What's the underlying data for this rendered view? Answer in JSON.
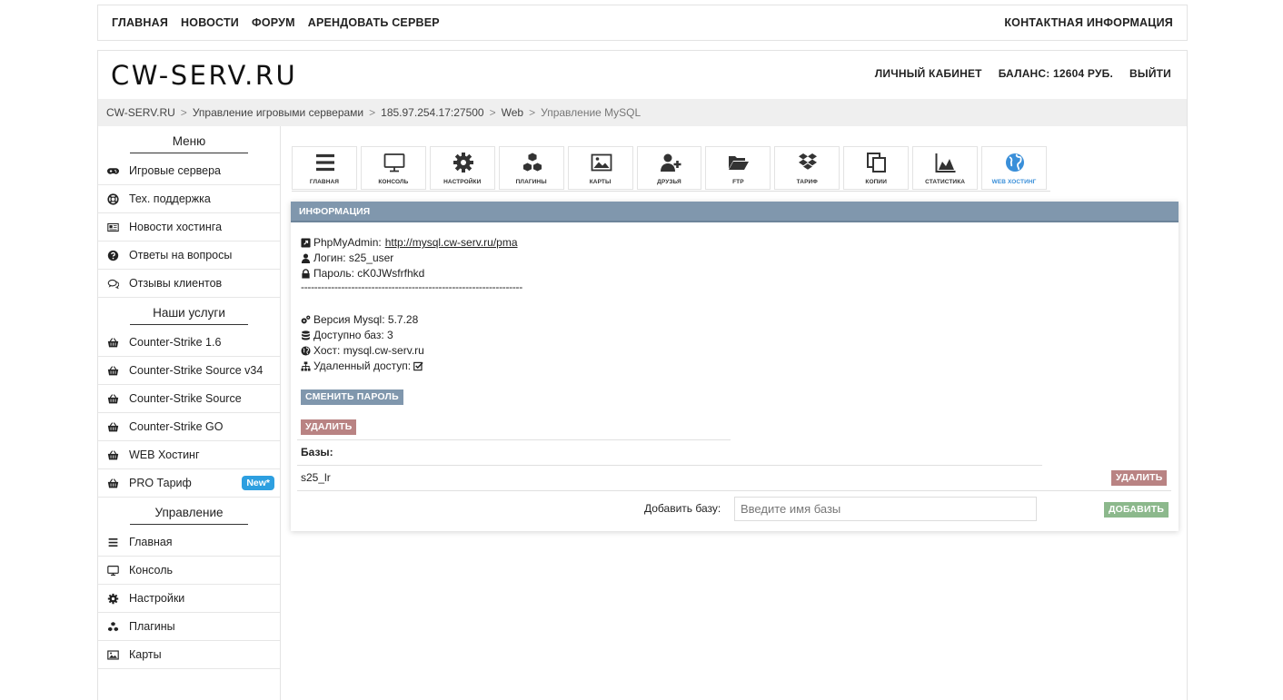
{
  "topnav": {
    "items": [
      "ГЛАВНАЯ",
      "НОВОСТИ",
      "ФОРУМ",
      "АРЕНДОВАТЬ СЕРВЕР"
    ],
    "contact": "КОНТАКТНАЯ ИНФОРМАЦИЯ"
  },
  "header": {
    "logo": "CW-SERV.RU",
    "cabinet": "ЛИЧНЫЙ КАБИНЕТ",
    "balance": "БАЛАНС: 12604 РУБ.",
    "logout": "ВЫЙТИ"
  },
  "breadcrumb": [
    "CW-SERV.RU",
    "Управление игровыми серверами",
    "185.97.254.17:27500",
    "Web",
    "Управление MySQL"
  ],
  "sidebar": {
    "menu_title": "Меню",
    "menu": [
      {
        "label": "Игровые сервера",
        "icon": "gamepad-icon"
      },
      {
        "label": "Тех. поддержка",
        "icon": "lifebuoy-icon"
      },
      {
        "label": "Новости хостинга",
        "icon": "newspaper-icon"
      },
      {
        "label": "Ответы на вопросы",
        "icon": "question-icon"
      },
      {
        "label": "Отзывы клиентов",
        "icon": "comments-icon"
      }
    ],
    "services_title": "Наши услуги",
    "services": [
      {
        "label": "Counter-Strike 1.6",
        "icon": "basket-icon"
      },
      {
        "label": "Counter-Strike Source v34",
        "icon": "basket-icon"
      },
      {
        "label": "Counter-Strike Source",
        "icon": "basket-icon"
      },
      {
        "label": "Counter-Strike GO",
        "icon": "basket-icon"
      },
      {
        "label": "WEB Хостинг",
        "icon": "basket-icon"
      },
      {
        "label": "PRO Тариф",
        "icon": "basket-icon",
        "badge": "New*"
      }
    ],
    "manage_title": "Управление",
    "manage": [
      {
        "label": "Главная",
        "icon": "bars-icon"
      },
      {
        "label": "Консоль",
        "icon": "monitor-icon"
      },
      {
        "label": "Настройки",
        "icon": "gear-icon"
      },
      {
        "label": "Плагины",
        "icon": "cubes-icon"
      },
      {
        "label": "Карты",
        "icon": "image-icon"
      }
    ]
  },
  "toolbar": [
    {
      "label": "ГЛАВНАЯ",
      "icon": "bars-icon"
    },
    {
      "label": "КОНСОЛЬ",
      "icon": "monitor-icon"
    },
    {
      "label": "НАСТРОЙКИ",
      "icon": "gear-icon"
    },
    {
      "label": "ПЛАГИНЫ",
      "icon": "cubes-icon"
    },
    {
      "label": "КАРТЫ",
      "icon": "image-icon"
    },
    {
      "label": "ДРУЗЬЯ",
      "icon": "user-plus-icon"
    },
    {
      "label": "FTP",
      "icon": "folder-open-icon"
    },
    {
      "label": "ТАРИФ",
      "icon": "dropbox-icon"
    },
    {
      "label": "КОПИИ",
      "icon": "copy-icon"
    },
    {
      "label": "СТАТИСТИКА",
      "icon": "area-chart-icon"
    },
    {
      "label": "WEB ХОСТИНГ",
      "icon": "globe-icon",
      "active": true
    }
  ],
  "panel": {
    "title": "ИНФОРМАЦИЯ",
    "phpmyadmin_label": "PhpMyAdmin:",
    "phpmyadmin_url": "http://mysql.cw-serv.ru/pma",
    "login": "Логин: s25_user",
    "password": "Пароль: cK0JWsfrfhkd",
    "divider": "------------------------------------------------------------------",
    "version": "Версия Mysql: 5.7.28",
    "available": "Доступно баз: 3",
    "host": "Хост: mysql.cw-serv.ru",
    "remote": "Удаленный доступ:",
    "change_password": "СМЕНИТЬ ПАРОЛЬ",
    "delete": "УДАЛИТЬ",
    "bases_label": "Базы:",
    "bases": [
      {
        "name": "s25_lr",
        "delete": "УДАЛИТЬ"
      }
    ],
    "add_label": "Добавить базу:",
    "add_placeholder": "Введите имя базы",
    "add_button": "ДОБАВИТЬ"
  },
  "colors": {
    "panel_header": "#8097ad",
    "delete_button": "#b98383",
    "add_button": "#8cb88c",
    "badge": "#2d9fe0",
    "active_tool": "#3a8fd9"
  }
}
